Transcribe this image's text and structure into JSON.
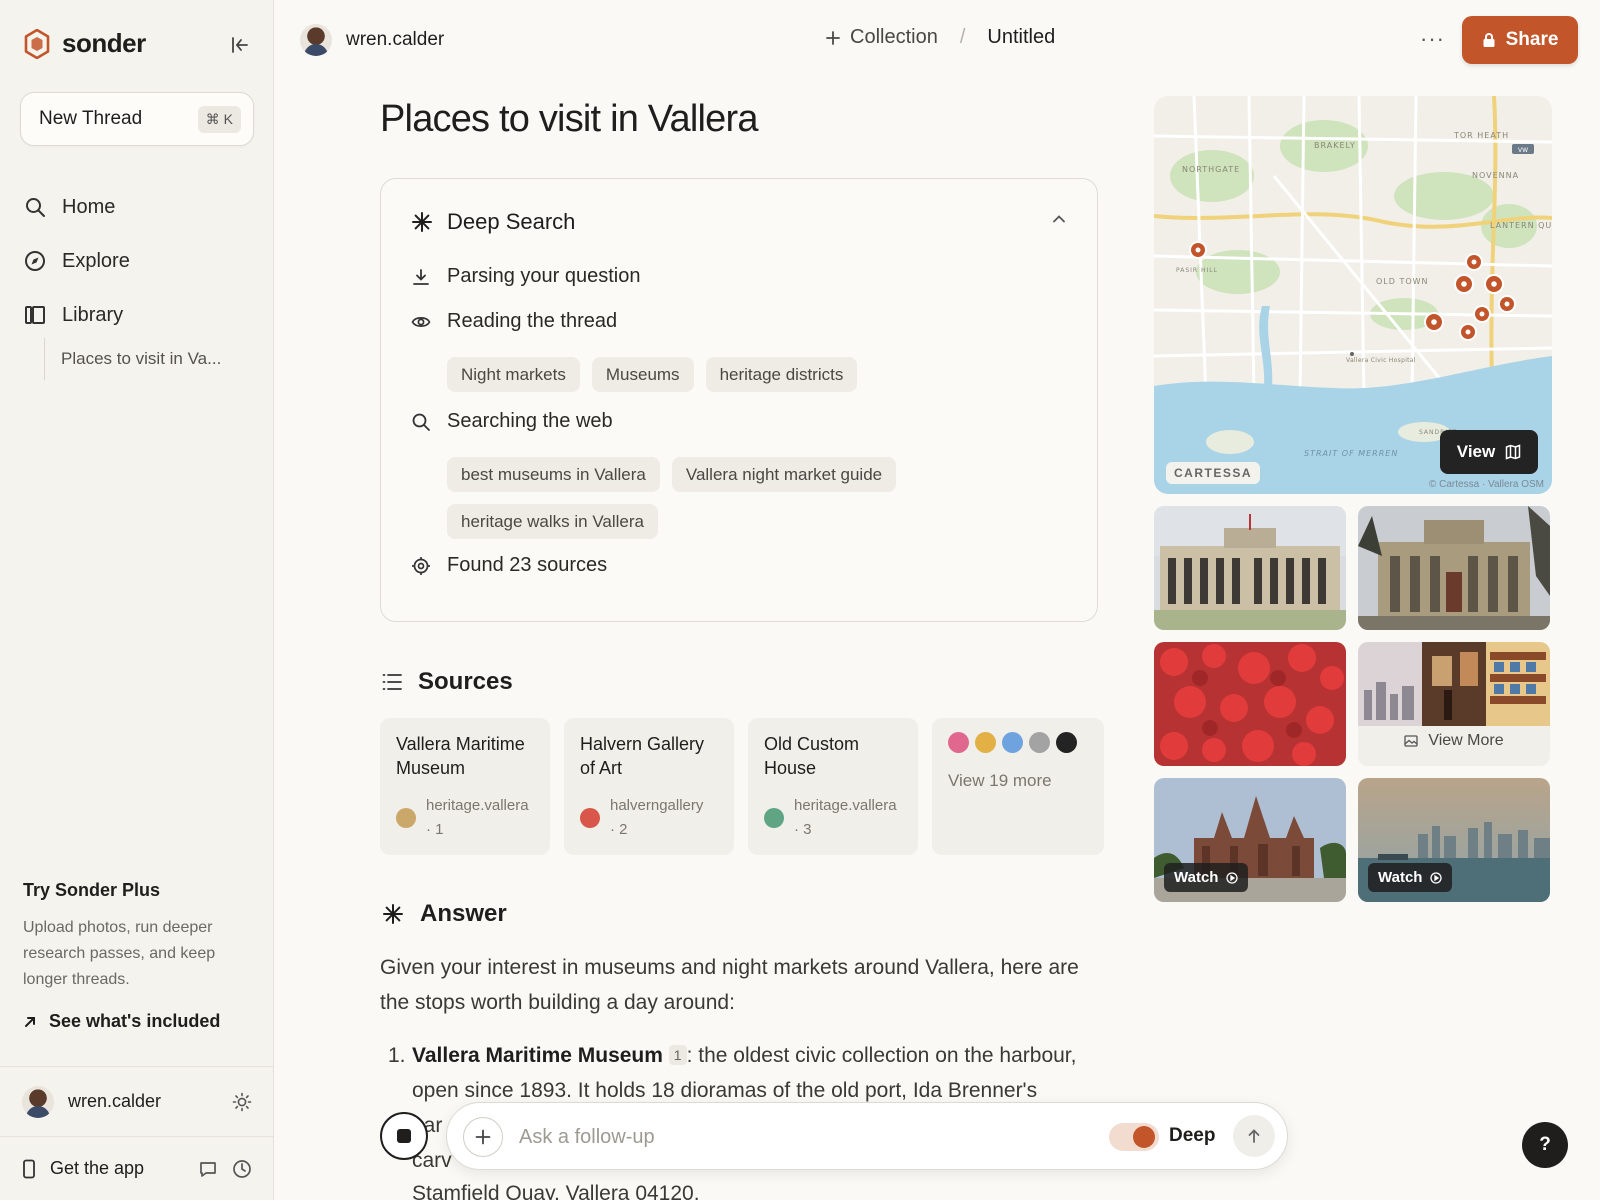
{
  "app": {
    "name": "sonder"
  },
  "sidebar": {
    "new_thread": {
      "label": "New Thread",
      "shortcut": "⌘ K"
    },
    "nav": [
      {
        "label": "Home",
        "icon": "search-icon"
      },
      {
        "label": "Explore",
        "icon": "compass-icon"
      },
      {
        "label": "Library",
        "icon": "library-icon"
      }
    ],
    "recent_thread": "Places to visit in Va...",
    "promo": {
      "title": "Try Sonder Plus",
      "description": "Upload photos, run deeper research passes, and keep longer threads.",
      "link": "See what's included"
    },
    "user": {
      "name": "wren.calder"
    },
    "footer": {
      "get_app": "Get the app"
    }
  },
  "topbar": {
    "user": "wren.calder",
    "collection": "Collection",
    "thread_name": "Untitled",
    "share_label": "Share"
  },
  "page": {
    "title": "Places to visit in Vallera"
  },
  "deep_search": {
    "title": "Deep Search",
    "steps": {
      "parsing": "Parsing your question",
      "reading": "Reading the thread",
      "searching": "Searching the web",
      "found": "Found 23 sources"
    },
    "topic_chips": [
      "Night markets",
      "Museums",
      "heritage districts"
    ],
    "query_chips": [
      "best museums in Vallera",
      "Vallera night market guide",
      "heritage walks in Vallera"
    ]
  },
  "sources": {
    "heading": "Sources",
    "items": [
      {
        "title": "Vallera Maritime Museum",
        "domain": "heritage.vallera",
        "index": "1",
        "color": "#c9a86a"
      },
      {
        "title": "Halvern Gallery of Art",
        "domain": "halverngallery",
        "index": "2",
        "color": "#d8574a"
      },
      {
        "title": "Old Custom House",
        "domain": "heritage.vallera",
        "index": "3",
        "color": "#5fa584"
      }
    ],
    "more": {
      "label": "View 19 more",
      "colors": [
        "#e0688e",
        "#e2b045",
        "#6fa3e0",
        "#a3a3a3",
        "#232323"
      ]
    }
  },
  "answer": {
    "heading": "Answer",
    "intro": "Given your interest in museums and night markets around Vallera, here are the stops worth building a day around:",
    "item1_num": "1.",
    "item1_title": "Vallera Maritime Museum",
    "item1_cite": "1",
    "item1_text": ": the oldest civic collection on the harbour, open since 1893. It holds 18 dioramas of the old port, Ida Brenner's",
    "item1_cut1": "har",
    "item1_cut2": "carv",
    "item1_last": "Stamfield Quay, Vallera 04120."
  },
  "composer": {
    "placeholder": "Ask a follow-up",
    "mode_label": "Deep",
    "mode_on": true
  },
  "media": {
    "map": {
      "view_label": "View",
      "region_tag": "CARTESSA",
      "attribution": "© Cartessa · Vallera OSM",
      "labels": [
        "BRAKELY",
        "TOR HEATH",
        "NORTHGATE",
        "NOVENNA",
        "LANTERN QUARTER",
        "PASIR HILL",
        "OLD TOWN",
        "Vallera Civic Hospital",
        "SANDRIFT",
        "STRAIT OF MERREN"
      ]
    },
    "view_more_label": "View More",
    "watch_label": "Watch"
  },
  "help_label": "?"
}
